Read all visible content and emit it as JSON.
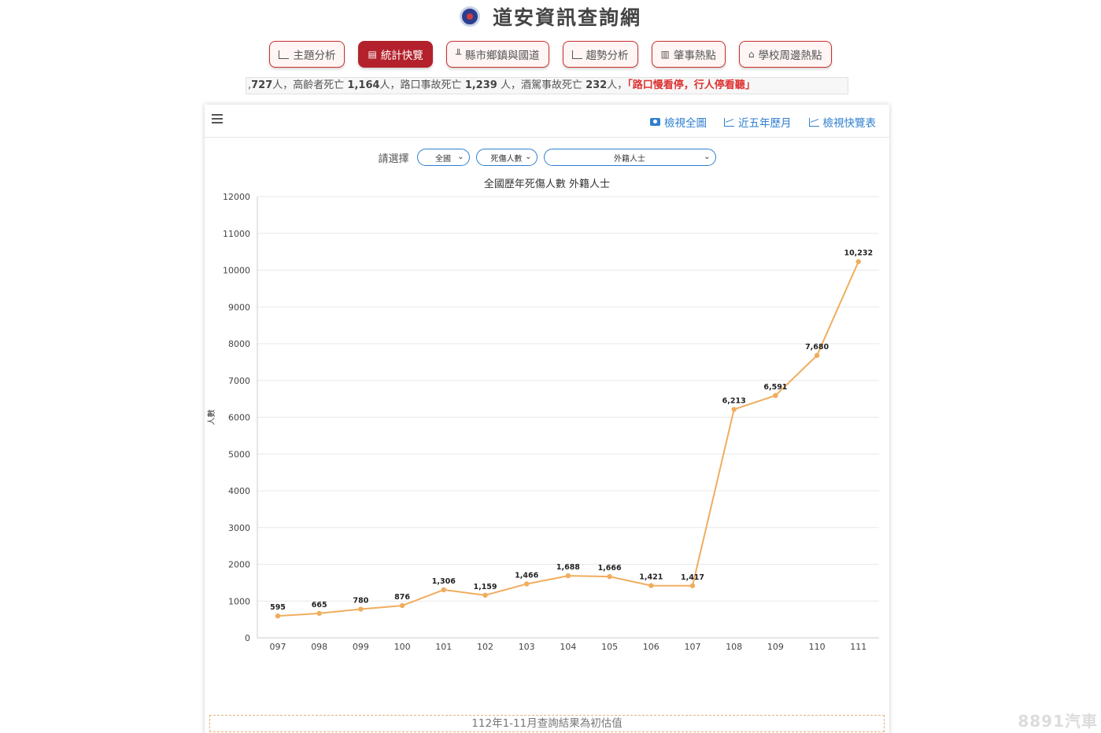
{
  "header": {
    "title": "道安資訊查詢網"
  },
  "nav": [
    {
      "label": "主題分析",
      "icon": "area-chart-icon",
      "active": false
    },
    {
      "label": "統計快覽",
      "icon": "newspaper-icon",
      "active": true
    },
    {
      "label": "縣市鄉鎮與國道",
      "icon": "bar-chart-icon",
      "active": false
    },
    {
      "label": "趨勢分析",
      "icon": "area-chart-icon",
      "active": false
    },
    {
      "label": "肇事熱點",
      "icon": "map-icon",
      "active": false
    },
    {
      "label": "學校周邊熱點",
      "icon": "school-icon",
      "active": false
    }
  ],
  "ticker": {
    "p1": ",",
    "n1": "727",
    "p2": "人，高齡者死亡 ",
    "n2": "1,164",
    "p3": "人，路口事故死亡 ",
    "n3": "1,239",
    "p4": " 人，酒駕事故死亡 ",
    "n4": "232",
    "p5": "人，",
    "highlight": "「路口慢看停，行人停看聽」"
  },
  "toolbar": {
    "links": [
      {
        "label": "檢視全圖",
        "icon": "camera-icon"
      },
      {
        "label": "近五年歷月",
        "icon": "area-chart-icon"
      },
      {
        "label": "檢視快覽表",
        "icon": "area-chart-icon"
      }
    ]
  },
  "filters": {
    "label": "請選擇",
    "region": "全國",
    "metric": "死傷人數",
    "group": "外籍人士"
  },
  "chart_data": {
    "type": "line",
    "title": "全國歷年死傷人數 外籍人士",
    "ylabel": "人數",
    "xlabel": "",
    "categories": [
      "097",
      "098",
      "099",
      "100",
      "101",
      "102",
      "103",
      "104",
      "105",
      "106",
      "107",
      "108",
      "109",
      "110",
      "111"
    ],
    "values": [
      595,
      665,
      780,
      876,
      1306,
      1159,
      1466,
      1688,
      1666,
      1421,
      1417,
      6213,
      6591,
      7680,
      10232
    ],
    "data_labels": [
      "595",
      "665",
      "780",
      "876",
      "1,306",
      "1,159",
      "1,466",
      "1,688",
      "1,666",
      "1,421",
      "1,417",
      "6,213",
      "6,591",
      "7,680",
      "10,232"
    ],
    "ylim": [
      0,
      12000
    ],
    "yticks": [
      "0",
      "1000",
      "2000",
      "3000",
      "4000",
      "5000",
      "6000",
      "7000",
      "8000",
      "9000",
      "10000",
      "11000",
      "12000"
    ],
    "grid": true,
    "line_color": "#f0ad5e"
  },
  "note": "112年1-11月查詢結果為初估值",
  "watermark": "8891汽車"
}
